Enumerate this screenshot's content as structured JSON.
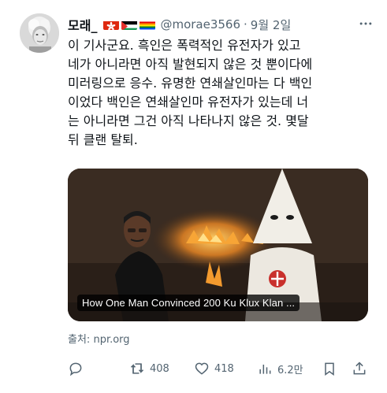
{
  "author": {
    "display_name": "모래_",
    "handle": "@morae3566",
    "separator": "·",
    "date": "9월 2일",
    "flags": [
      "hong-kong-flag",
      "palestine-flag",
      "rainbow-flag"
    ]
  },
  "tweet": {
    "text": "이 기사군요. 흑인은 폭력적인 유전자가 있고\n네가 아니라면 아직 발현되지 않은 것 뿐이다에\n미러링으로 응수. 유명한 연쇄살인마는 다 백인\n이었다 백인은 연쇄살인마 유전자가 있는데 너\n는 아니라면 그건 아직 나타나지 않은 것. 몇달\n뒤 클랜 탈퇴."
  },
  "card": {
    "title": "How One Man Convinced 200 Ku Klux Klan ...",
    "source_label": "출처:",
    "source_domain": "npr.org"
  },
  "actions": {
    "reply_count": "",
    "retweet_count": "408",
    "like_count": "418",
    "view_count": "6.2만"
  },
  "colors": {
    "text_primary": "#0f1419",
    "text_secondary": "#536471"
  }
}
